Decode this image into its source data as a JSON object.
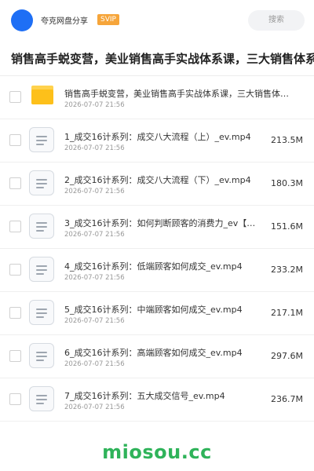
{
  "header": {
    "site_name": "夸克网盘分享",
    "vip_badge": "SVIP",
    "search_label": "搜索",
    "brand_color": "#1e6ff5"
  },
  "title": "销售高手蜕变营，美业销售高手实战体系课，三大销售体系",
  "items": [
    {
      "type": "folder",
      "name": "销售高手蜕变营，美业销售高手实战体系课，三大销售体…",
      "date": "2026-07-07 21:56",
      "size": ""
    },
    {
      "type": "file",
      "name": "1_成交16计系列：成交八大流程（上）_ev.mp4",
      "date": "2026-07-07 21:56",
      "size": "213.5M"
    },
    {
      "type": "file",
      "name": "2_成交16计系列：成交八大流程（下）_ev.mp4",
      "date": "2026-07-07 21:56",
      "size": "180.3M"
    },
    {
      "type": "file",
      "name": "3_成交16计系列：如何判断顾客的消费力_ev【公…",
      "date": "2026-07-07 21:56",
      "size": "151.6M"
    },
    {
      "type": "file",
      "name": "4_成交16计系列：低端顾客如何成交_ev.mp4",
      "date": "2026-07-07 21:56",
      "size": "233.2M"
    },
    {
      "type": "file",
      "name": "5_成交16计系列：中端顾客如何成交_ev.mp4",
      "date": "2026-07-07 21:56",
      "size": "217.1M"
    },
    {
      "type": "file",
      "name": "6_成交16计系列：高端顾客如何成交_ev.mp4",
      "date": "2026-07-07 21:56",
      "size": "297.6M"
    },
    {
      "type": "file",
      "name": "7_成交16计系列：五大成交信号_ev.mp4",
      "date": "2026-07-07 21:56",
      "size": "236.7M"
    }
  ],
  "watermark": "miosou.cc",
  "icons": {
    "folder": "folder-icon",
    "file": "video-file-icon"
  }
}
